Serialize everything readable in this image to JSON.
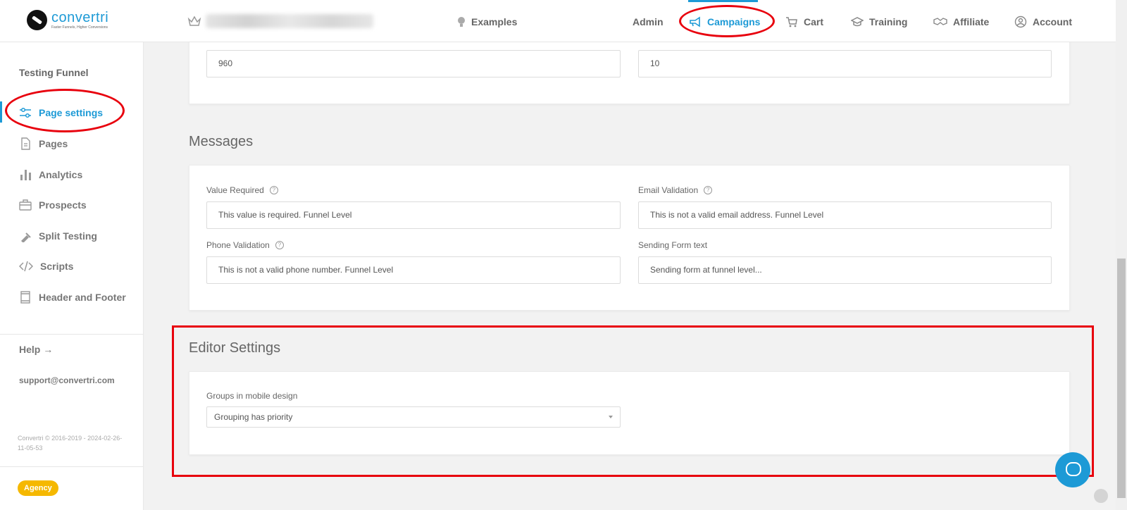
{
  "brand": {
    "name": "convertri",
    "tagline": "Faster Funnels, Higher Conversions"
  },
  "header": {
    "nav": [
      {
        "label": "Examples",
        "icon": "lightbulb-icon"
      },
      {
        "label": "Admin",
        "icon": ""
      },
      {
        "label": "Campaigns",
        "icon": "megaphone-icon"
      },
      {
        "label": "Cart",
        "icon": "cart-icon"
      },
      {
        "label": "Training",
        "icon": "graduation-cap-icon"
      },
      {
        "label": "Affiliate",
        "icon": "handshake-icon"
      },
      {
        "label": "Account",
        "icon": "user-circle-icon"
      }
    ],
    "active_nav": "Campaigns"
  },
  "sidebar": {
    "title": "Testing Funnel",
    "items": [
      {
        "label": "Page settings",
        "icon": "sliders-icon"
      },
      {
        "label": "Pages",
        "icon": "document-icon"
      },
      {
        "label": "Analytics",
        "icon": "bar-chart-icon"
      },
      {
        "label": "Prospects",
        "icon": "briefcase-icon"
      },
      {
        "label": "Split Testing",
        "icon": "flask-icon"
      },
      {
        "label": "Scripts",
        "icon": "code-icon"
      },
      {
        "label": "Header and Footer",
        "icon": "layout-icon"
      }
    ],
    "active_item": "Page settings",
    "help_label": "Help →",
    "support_email": "support@convertri.com",
    "copyright": "Convertri © 2016-2019 - 2024-02-26-11-05-53",
    "plan_badge": "Agency"
  },
  "top_card": {
    "width_value": "960",
    "second_value": "10"
  },
  "messages": {
    "title": "Messages",
    "value_required_label": "Value Required",
    "value_required_value": "This value is required. Funnel Level",
    "email_validation_label": "Email Validation",
    "email_validation_value": "This is not a valid email address. Funnel Level",
    "phone_validation_label": "Phone Validation",
    "phone_validation_value": "This is not a valid phone number. Funnel Level",
    "sending_form_label": "Sending Form text",
    "sending_form_value": "Sending form at funnel level..."
  },
  "editor_settings": {
    "title": "Editor Settings",
    "groups_label": "Groups in mobile design",
    "groups_value": "Grouping has priority"
  },
  "colors": {
    "accent": "#1d9ad6",
    "annotation": "#e8000d",
    "badge": "#f5b800"
  }
}
